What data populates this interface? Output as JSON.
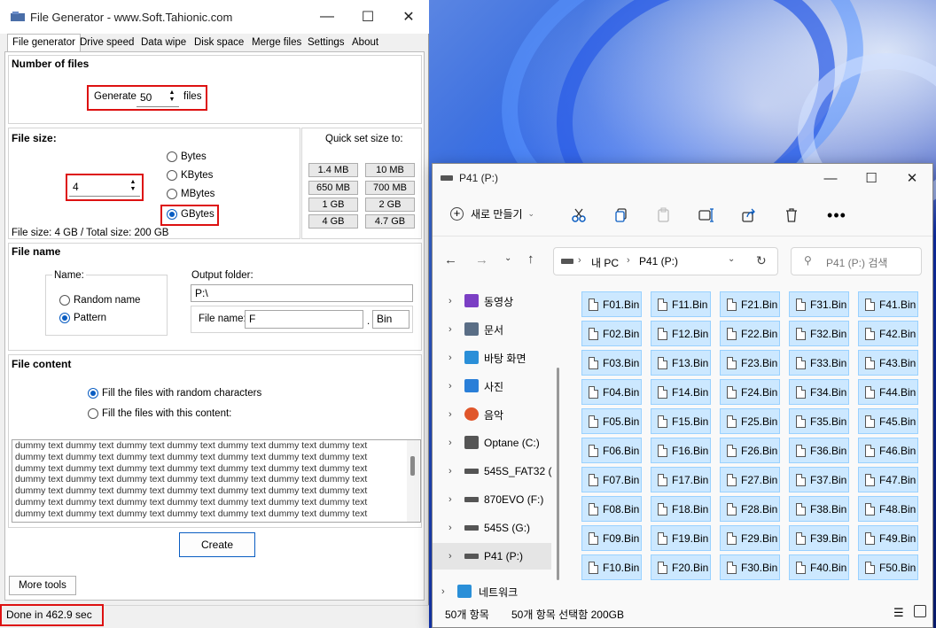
{
  "file_generator": {
    "title": "File Generator  -  www.Soft.Tahionic.com",
    "tabs": [
      "File generator",
      "Drive speed",
      "Data wipe",
      "Disk space",
      "Merge files",
      "Settings",
      "About"
    ],
    "number_of_files": {
      "heading": "Number of files",
      "generate_label": "Generate",
      "count": "50",
      "files_label": "files"
    },
    "file_size": {
      "heading": "File size:",
      "value": "4",
      "units": [
        {
          "label": "Bytes",
          "selected": false
        },
        {
          "label": "KBytes",
          "selected": false
        },
        {
          "label": "MBytes",
          "selected": false
        },
        {
          "label": "GBytes",
          "selected": true
        }
      ],
      "summary": "File size: 4 GB / Total size: 200 GB",
      "quick_set_title": "Quick set size to:",
      "quick_set": [
        "1.4 MB",
        "10 MB",
        "650 MB",
        "700 MB",
        "1 GB",
        "2 GB",
        "4 GB",
        "4.7 GB"
      ]
    },
    "file_name": {
      "heading": "File name",
      "name_group_label": "Name:",
      "options": [
        {
          "label": "Random name",
          "selected": false
        },
        {
          "label": "Pattern",
          "selected": true
        }
      ],
      "output_folder_label": "Output folder:",
      "output_folder": "P:\\",
      "file_name_label": "File name:",
      "file_name": "F",
      "dot": ".",
      "extension": "Bin"
    },
    "file_content": {
      "heading": "File content",
      "options": [
        {
          "label": "Fill the files with random characters",
          "selected": true
        },
        {
          "label": "Fill the files with this content:",
          "selected": false
        }
      ],
      "content_lines": [
        "dummy text dummy text dummy text dummy text dummy text dummy text dummy text",
        "dummy text dummy text dummy text dummy text dummy text dummy text dummy text",
        "dummy text dummy text dummy text dummy text dummy text dummy text dummy text",
        "dummy text dummy text dummy text dummy text dummy text dummy text dummy text",
        "dummy text dummy text dummy text dummy text dummy text dummy text dummy text",
        "dummy text dummy text dummy text dummy text dummy text dummy text dummy text",
        "dummy text dummy text dummy text dummy text dummy text dummy text dummy text"
      ]
    },
    "create_button": "Create",
    "more_tools_button": "More tools",
    "status": "Done in 462.9 sec",
    "highlight_color": "#dd1111"
  },
  "explorer": {
    "title": "P41 (P:)",
    "new_button": "새로 만들기",
    "breadcrumb": [
      "내 PC",
      "P41 (P:)"
    ],
    "search_placeholder": "P41 (P:) 검색",
    "nav_items": [
      {
        "label": "동영상",
        "icon": "video-icon"
      },
      {
        "label": "문서",
        "icon": "document-icon"
      },
      {
        "label": "바탕 화면",
        "icon": "desktop-icon"
      },
      {
        "label": "사진",
        "icon": "picture-icon"
      },
      {
        "label": "음악",
        "icon": "music-icon"
      },
      {
        "label": "Optane (C:)",
        "icon": "windows-drive-icon"
      },
      {
        "label": "545S_FAT32 (",
        "icon": "drive-icon"
      },
      {
        "label": "870EVO (F:)",
        "icon": "drive-icon"
      },
      {
        "label": "545S (G:)",
        "icon": "drive-icon"
      },
      {
        "label": "P41 (P:)",
        "icon": "drive-icon"
      },
      {
        "label": "네트워크",
        "icon": "network-icon"
      }
    ],
    "files": [
      "F01.Bin",
      "F02.Bin",
      "F03.Bin",
      "F04.Bin",
      "F05.Bin",
      "F06.Bin",
      "F07.Bin",
      "F08.Bin",
      "F09.Bin",
      "F10.Bin",
      "F11.Bin",
      "F12.Bin",
      "F13.Bin",
      "F14.Bin",
      "F15.Bin",
      "F16.Bin",
      "F17.Bin",
      "F18.Bin",
      "F19.Bin",
      "F20.Bin",
      "F21.Bin",
      "F22.Bin",
      "F23.Bin",
      "F24.Bin",
      "F25.Bin",
      "F26.Bin",
      "F27.Bin",
      "F28.Bin",
      "F29.Bin",
      "F30.Bin",
      "F31.Bin",
      "F32.Bin",
      "F33.Bin",
      "F34.Bin",
      "F35.Bin",
      "F36.Bin",
      "F37.Bin",
      "F38.Bin",
      "F39.Bin",
      "F40.Bin",
      "F41.Bin",
      "F42.Bin",
      "F43.Bin",
      "F44.Bin",
      "F45.Bin",
      "F46.Bin",
      "F47.Bin",
      "F48.Bin",
      "F49.Bin",
      "F50.Bin"
    ],
    "status_count": "50개 항목",
    "status_selected": "50개 항목 선택함 200GB"
  }
}
